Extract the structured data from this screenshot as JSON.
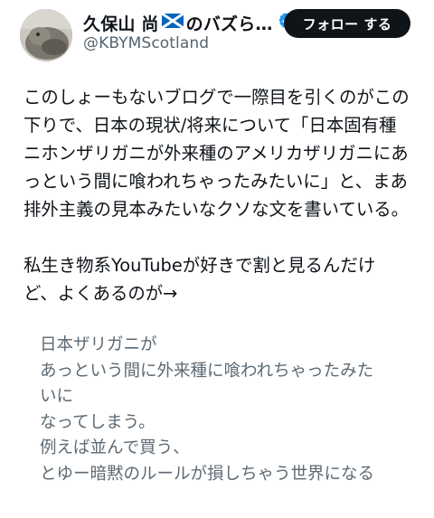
{
  "header": {
    "display_name": "久保山 尚",
    "display_name_suffix": "のバズら…",
    "handle": "@KBYMScotland",
    "follow_label": "フォロー する",
    "flag_icon": "scotland-flag-icon",
    "verified_icon": "verified-badge-icon",
    "colors": {
      "follow_bg": "#0f1419",
      "verified": "#1d9bf0",
      "saltire_blue": "#0065bd"
    }
  },
  "post": {
    "paragraph1": [
      "このしょーもないブログで一際目を引くのがこの",
      "下りで、日本の現状/将来について「日本固有種",
      "ニホンザリガニが外来種のアメリカザリガニにあ",
      "っという間に喰われちゃったみたいに」と、まあ",
      "排外主義の見本みたいなクソな文を書いている。"
    ],
    "paragraph2": [
      "私生き物系YouTubeが好きで割と見るんだけ",
      "ど、よくあるのが→"
    ]
  },
  "quote": {
    "lines": [
      "日本ザリガニが",
      "あっという間に外来種に喰われちゃったみた",
      "いに",
      "なってしまう。",
      "例えば並んで買う、",
      "とゆー暗黙のルールが損しちゃう世界になる"
    ]
  }
}
